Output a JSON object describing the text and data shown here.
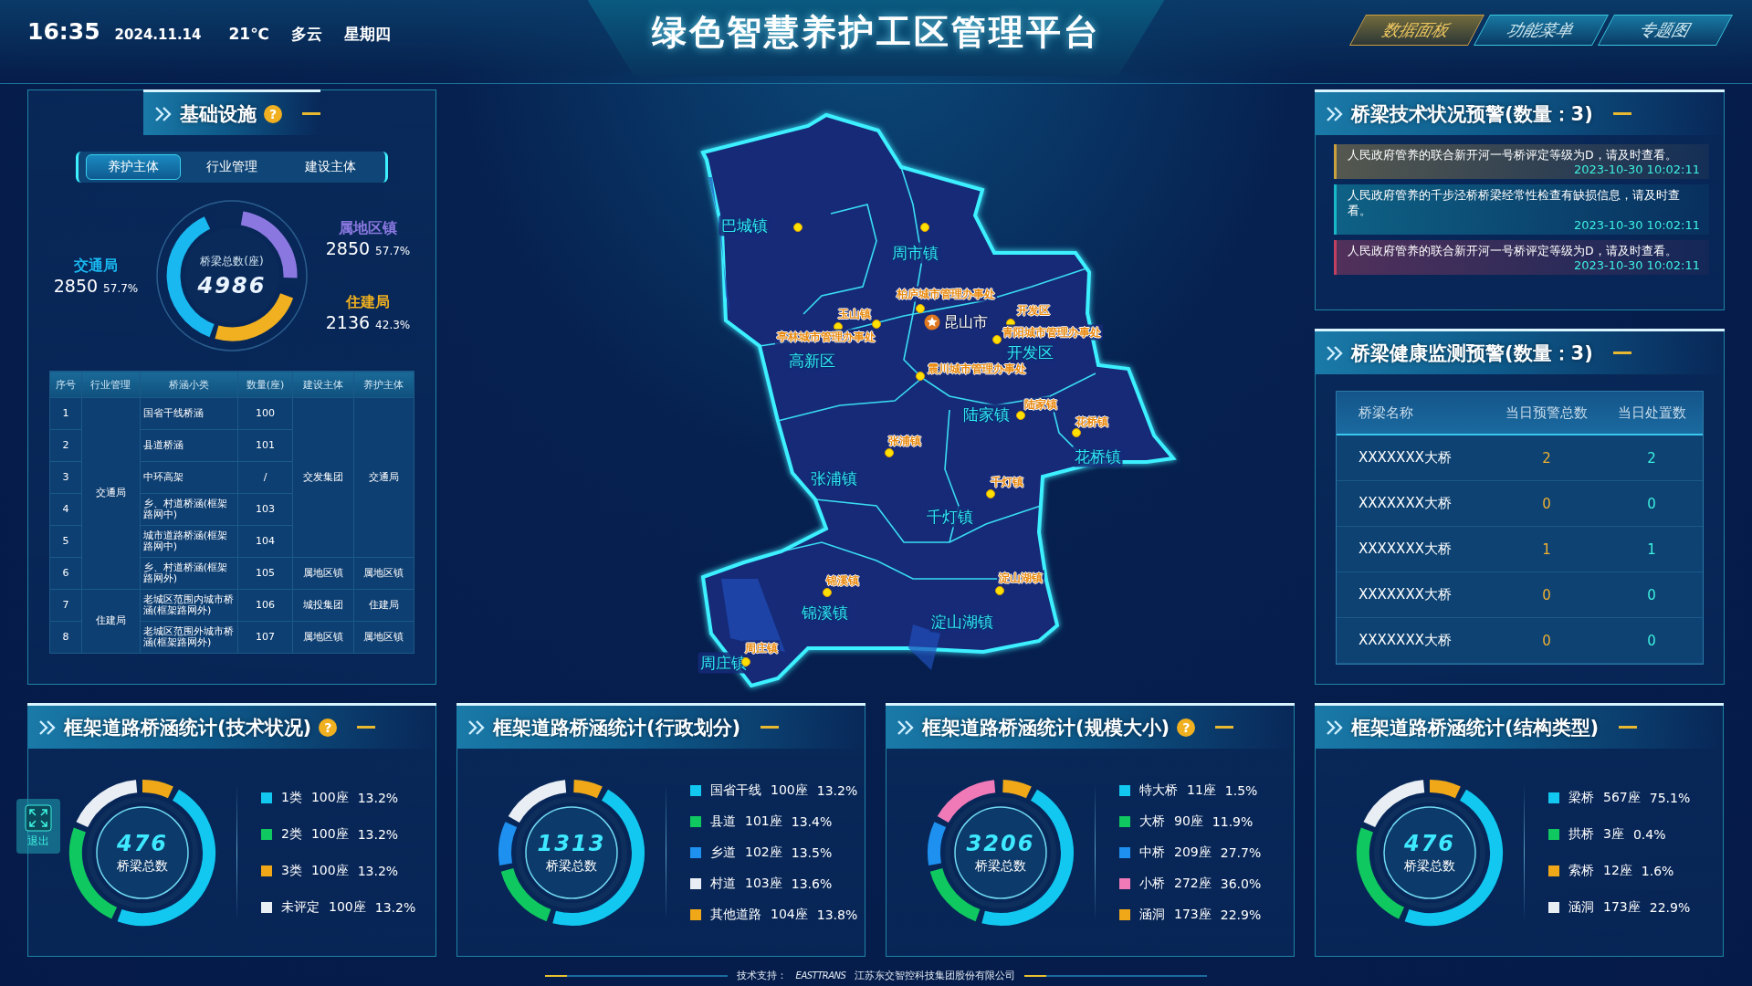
{
  "header": {
    "time": "16:35",
    "date": "2024.11.14",
    "temperature": "21℃",
    "weather": "多云",
    "weekday": "星期四",
    "title": "绿色智慧养护工区管理平台",
    "nav": [
      {
        "label": "数据面板",
        "selected": true
      },
      {
        "label": "功能菜单",
        "selected": false
      },
      {
        "label": "专题图",
        "selected": false
      }
    ]
  },
  "infrastructure": {
    "title": "基础设施",
    "help": "?",
    "tabs": [
      {
        "label": "养护主体",
        "selected": true
      },
      {
        "label": "行业管理",
        "selected": false
      },
      {
        "label": "建设主体",
        "selected": false
      }
    ],
    "donut": {
      "center_label": "桥梁总数(座)",
      "total": "4986",
      "segments": [
        {
          "name": "交通局",
          "value": "2850",
          "percent": "57.7%",
          "color": "#19b8f0"
        },
        {
          "name": "属地区镇",
          "value": "2850",
          "percent": "57.7%",
          "color": "#8a78e0"
        },
        {
          "name": "住建局",
          "value": "2136",
          "percent": "42.3%",
          "color": "#f0b020"
        }
      ]
    },
    "table": {
      "columns": [
        "序号",
        "行业管理",
        "桥涵小类",
        "数量(座)",
        "建设主体",
        "养护主体"
      ],
      "groups": [
        {
          "industry": "交通局",
          "builders": [
            {
              "builder": "交发集团",
              "maintainer": "交通局",
              "rows": [
                {
                  "no": "1",
                  "type": "国省干线桥涵",
                  "count": "100"
                },
                {
                  "no": "2",
                  "type": "县道桥涵",
                  "count": "101"
                },
                {
                  "no": "3",
                  "type": "中环高架",
                  "count": "/"
                },
                {
                  "no": "4",
                  "type": "乡、村道桥涵(框架路网中)",
                  "count": "103"
                },
                {
                  "no": "5",
                  "type": "城市道路桥涵(框架路网中)",
                  "count": "104"
                }
              ]
            },
            {
              "builder": "属地区镇",
              "maintainer": "属地区镇",
              "rows": [
                {
                  "no": "6",
                  "type": "乡、村道桥涵(框架路网外)",
                  "count": "105"
                }
              ]
            }
          ]
        },
        {
          "industry": "住建局",
          "builders": [
            {
              "builder": "城投集团",
              "maintainer": "住建局",
              "rows": [
                {
                  "no": "7",
                  "type": "老城区范围内城市桥涵(框架路网外)",
                  "count": "106"
                }
              ]
            },
            {
              "builder": "属地区镇",
              "maintainer": "属地区镇",
              "rows": [
                {
                  "no": "8",
                  "type": "老城区范围外城市桥涵(框架路网外)",
                  "count": "107"
                }
              ]
            }
          ]
        }
      ]
    }
  },
  "map": {
    "city": "昆山市",
    "regions": [
      "巴城镇",
      "周市镇",
      "高新区",
      "开发区",
      "陆家镇",
      "花桥镇",
      "张浦镇",
      "千灯镇",
      "锦溪镇",
      "淀山湖镇",
      "周庄镇"
    ],
    "markers": [
      "柏庐城市管理办事处",
      "玉山镇",
      "亭林城市管理办事处",
      "开发区",
      "青阳城市管理办事处",
      "震川城市管理办事处",
      "陆家镇",
      "花桥镇",
      "张浦镇",
      "千灯镇",
      "锦溪镇",
      "淀山湖镇",
      "周庄镇"
    ]
  },
  "tech_alerts": {
    "title": "桥梁技术状况预警(数量：3)",
    "items": [
      {
        "text": "人民政府管养的联合新开河一号桥评定等级为D，请及时查看。",
        "time": "2023-10-30 10:02:11",
        "color": "#c8a040"
      },
      {
        "text": "人民政府管养的千步泾桥桥梁经常性检查有缺损信息，请及时查看。",
        "time": "2023-10-30 10:02:11",
        "color": "#18b8c8"
      },
      {
        "text": "人民政府管养的联合新开河一号桥评定等级为D，请及时查看。",
        "time": "2023-10-30 10:02:11",
        "color": "#c04060"
      }
    ]
  },
  "health_alerts": {
    "title": "桥梁健康监测预警(数量：3)",
    "columns": [
      "桥梁名称",
      "当日预警总数",
      "当日处置数"
    ],
    "rows": [
      {
        "name": "XXXXXXX大桥",
        "warnings": "2",
        "handled": "2"
      },
      {
        "name": "XXXXXXX大桥",
        "warnings": "0",
        "handled": "0"
      },
      {
        "name": "XXXXXXX大桥",
        "warnings": "1",
        "handled": "1"
      },
      {
        "name": "XXXXXXX大桥",
        "warnings": "0",
        "handled": "0"
      },
      {
        "name": "XXXXXXX大桥",
        "warnings": "0",
        "handled": "0"
      }
    ]
  },
  "stats": [
    {
      "title": "框架道路桥涵统计(技术状况)",
      "help": "?",
      "total": "476",
      "total_label": "桥梁总数",
      "items": [
        {
          "name": "1类",
          "count": "100座",
          "percent": "13.2%",
          "color": "#12c8f0"
        },
        {
          "name": "2类",
          "count": "100座",
          "percent": "13.2%",
          "color": "#10c860"
        },
        {
          "name": "3类",
          "count": "100座",
          "percent": "13.2%",
          "color": "#f0a818"
        },
        {
          "name": "未评定",
          "count": "100座",
          "percent": "13.2%",
          "color": "#e8eef4"
        }
      ]
    },
    {
      "title": "框架道路桥涵统计(行政划分)",
      "total": "1313",
      "total_label": "桥梁总数",
      "items": [
        {
          "name": "国省干线",
          "count": "100座",
          "percent": "13.2%",
          "color": "#12c8f0"
        },
        {
          "name": "县道",
          "count": "101座",
          "percent": "13.4%",
          "color": "#10c860"
        },
        {
          "name": "乡道",
          "count": "102座",
          "percent": "13.5%",
          "color": "#1e90f0"
        },
        {
          "name": "村道",
          "count": "103座",
          "percent": "13.6%",
          "color": "#e8eef4"
        },
        {
          "name": "其他道路",
          "count": "104座",
          "percent": "13.8%",
          "color": "#f0a818"
        }
      ]
    },
    {
      "title": "框架道路桥涵统计(规模大小)",
      "help": "?",
      "total": "3206",
      "total_label": "桥梁总数",
      "items": [
        {
          "name": "特大桥",
          "count": "11座",
          "percent": "1.5%",
          "color": "#12c8f0"
        },
        {
          "name": "大桥",
          "count": "90座",
          "percent": "11.9%",
          "color": "#10c860"
        },
        {
          "name": "中桥",
          "count": "209座",
          "percent": "27.7%",
          "color": "#1e90f0"
        },
        {
          "name": "小桥",
          "count": "272座",
          "percent": "36.0%",
          "color": "#f07ab8"
        },
        {
          "name": "涵洞",
          "count": "173座",
          "percent": "22.9%",
          "color": "#f0a818"
        }
      ]
    },
    {
      "title": "框架道路桥涵统计(结构类型)",
      "total": "476",
      "total_label": "桥梁总数",
      "items": [
        {
          "name": "梁桥",
          "count": "567座",
          "percent": "75.1%",
          "color": "#12c8f0"
        },
        {
          "name": "拱桥",
          "count": "3座",
          "percent": "0.4%",
          "color": "#10c860"
        },
        {
          "name": "索桥",
          "count": "12座",
          "percent": "1.6%",
          "color": "#f0a818"
        },
        {
          "name": "涵洞",
          "count": "173座",
          "percent": "22.9%",
          "color": "#e8eef4"
        }
      ]
    }
  ],
  "exit_button": {
    "label": "退出"
  },
  "footer": {
    "prefix": "技术支持：",
    "logo": "EASTTRANS",
    "company": "江苏东交智控科技集团股份有限公司"
  }
}
